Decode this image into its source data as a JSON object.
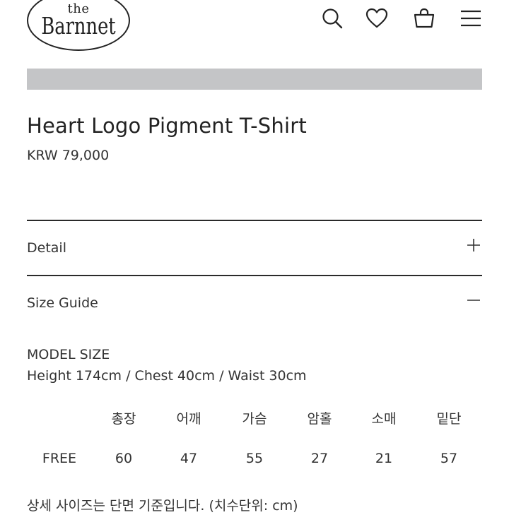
{
  "header": {
    "logo_small": "the",
    "logo_big": "Barnnet",
    "icons": [
      "search-icon",
      "heart-icon",
      "shopping-bag-icon",
      "menu-icon"
    ]
  },
  "product": {
    "title": "Heart Logo Pigment T-Shirt",
    "price": "KRW 79,000"
  },
  "accordion": {
    "detail": {
      "label": "Detail",
      "toggle": "+",
      "expanded": false
    },
    "size_guide": {
      "label": "Size Guide",
      "toggle": "−",
      "expanded": true
    }
  },
  "size_guide": {
    "model_title": "MODEL SIZE",
    "model_desc": "Height 174cm / Chest 40cm / Waist 30cm",
    "columns": [
      "",
      "총장",
      "어깨",
      "가슴",
      "암홀",
      "소매",
      "밑단"
    ],
    "rows": [
      [
        "FREE",
        "60",
        "47",
        "55",
        "27",
        "21",
        "57"
      ]
    ],
    "note": "상세 사이즈는 단면 기준입니다. (치수단위: cm)"
  },
  "colors": {
    "text": "#222222",
    "banner": "#c4c5c7",
    "rule": "#2a2a2a"
  }
}
